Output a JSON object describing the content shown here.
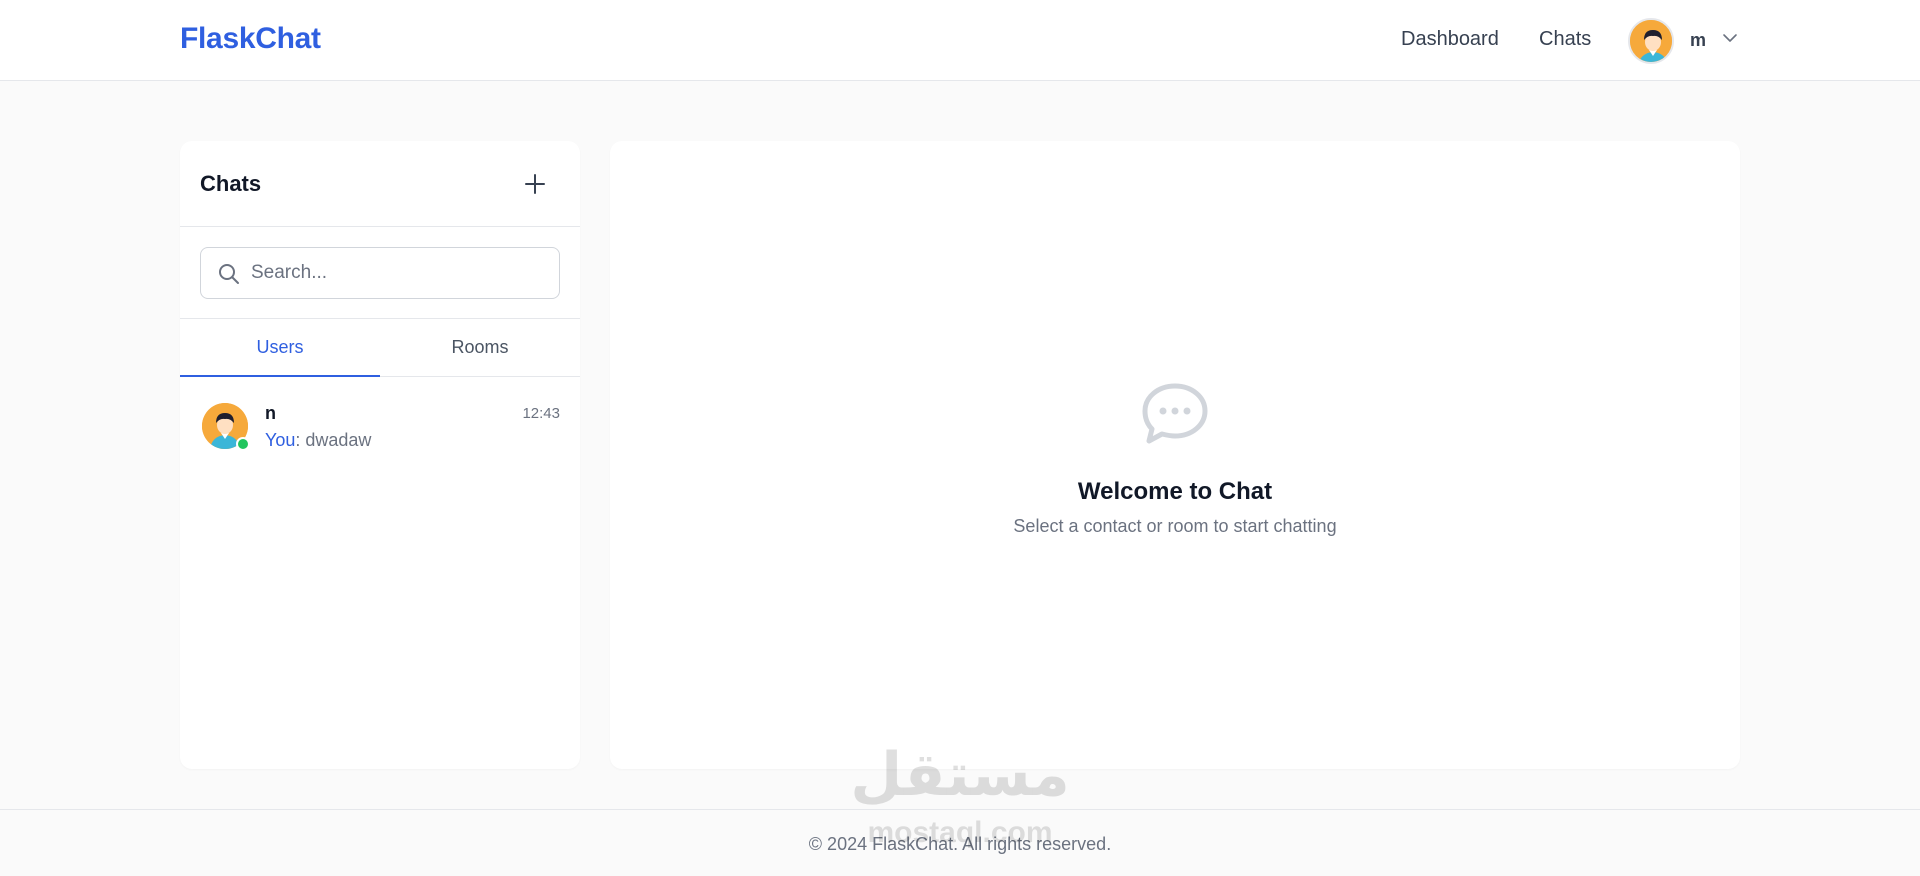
{
  "navbar": {
    "brand": "FlaskChat",
    "links": [
      "Dashboard",
      "Chats"
    ],
    "user_name": "m"
  },
  "sidebar": {
    "title": "Chats",
    "search_placeholder": "Search...",
    "tabs": [
      {
        "label": "Users",
        "active": true
      },
      {
        "label": "Rooms",
        "active": false
      }
    ],
    "chats": [
      {
        "name": "n",
        "time": "12:43",
        "you_label": "You",
        "message": ": dwadaw",
        "online": true
      }
    ]
  },
  "main": {
    "welcome_title": "Welcome to Chat",
    "welcome_subtitle": "Select a contact or room to start chatting"
  },
  "footer": {
    "text": "© 2024 FlaskChat. All rights reserved."
  },
  "watermark": {
    "arabic": "مستقل",
    "latin": "mostaql.com"
  },
  "colors": {
    "accent": "#2f5fe0",
    "online": "#22c55e",
    "avatar_bg": "#f6a93b"
  }
}
